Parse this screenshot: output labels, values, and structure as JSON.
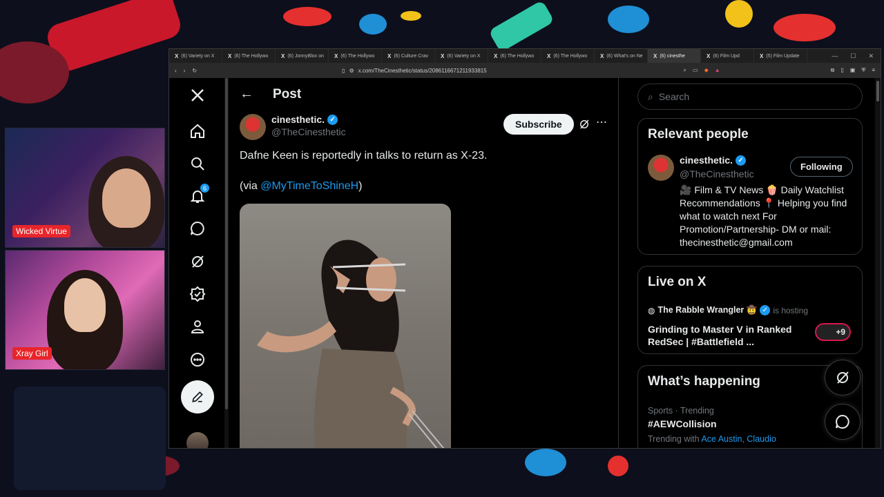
{
  "browser": {
    "tabs": [
      {
        "label": "(6) Variety on X"
      },
      {
        "label": "(6) The Hollywo"
      },
      {
        "label": "(6) JonnyBlox on"
      },
      {
        "label": "(6) The Hollywo"
      },
      {
        "label": "(6) Culture Crav"
      },
      {
        "label": "(6) Variety on X"
      },
      {
        "label": "(6) The Hollywo"
      },
      {
        "label": "(6) The Hollywo"
      },
      {
        "label": "(6) What's on Ne"
      },
      {
        "label": "(6) cinesthe",
        "active": true
      },
      {
        "label": "(6) Film Upd"
      },
      {
        "label": "(5) Film Update"
      }
    ],
    "url": "x.com/TheCinesthetic/status/2086116671211933815"
  },
  "overlay": {
    "cam1_label": "Wicked Virtue",
    "cam2_label": "Xray Girl"
  },
  "nav": {
    "notification_count": "6"
  },
  "post": {
    "header_title": "Post",
    "author_name": "cinesthetic.",
    "author_handle": "@TheCinesthetic",
    "subscribe_label": "Subscribe",
    "text": "Dafne Keen is reportedly in talks to return as X-23.",
    "via_prefix": "(via ",
    "via_link": "@MyTimeToShineH",
    "via_suffix": ")"
  },
  "sidebar": {
    "search_placeholder": "Search",
    "relevant": {
      "title": "Relevant people",
      "name": "cinesthetic.",
      "handle": "@TheCinesthetic",
      "follow_label": "Following",
      "bio": "🎥 Film & TV News 🍿 Daily Watchlist Recommendations 📍 Helping you find what to watch next For Promotion/Partnership- DM or mail: thecinesthetic@gmail.com"
    },
    "live": {
      "title": "Live on X",
      "host": "The Rabble Wrangler 🤠",
      "host_suffix": "is hosting",
      "stream_title": "Grinding to Master V in Ranked RedSec | #Battlefield ...",
      "listeners": "+9"
    },
    "happening": {
      "title": "What’s happening",
      "meta": "Sports · Trending",
      "topic": "#AEWCollision",
      "with_prefix": "Trending with",
      "with_1": "Ace Austin",
      "with_2": "Claudio"
    }
  },
  "colors": {
    "accent": "#1d9bf0",
    "background": "#000000",
    "live_ring": "#d6174e",
    "cam_label_bg": "#e8252a"
  }
}
